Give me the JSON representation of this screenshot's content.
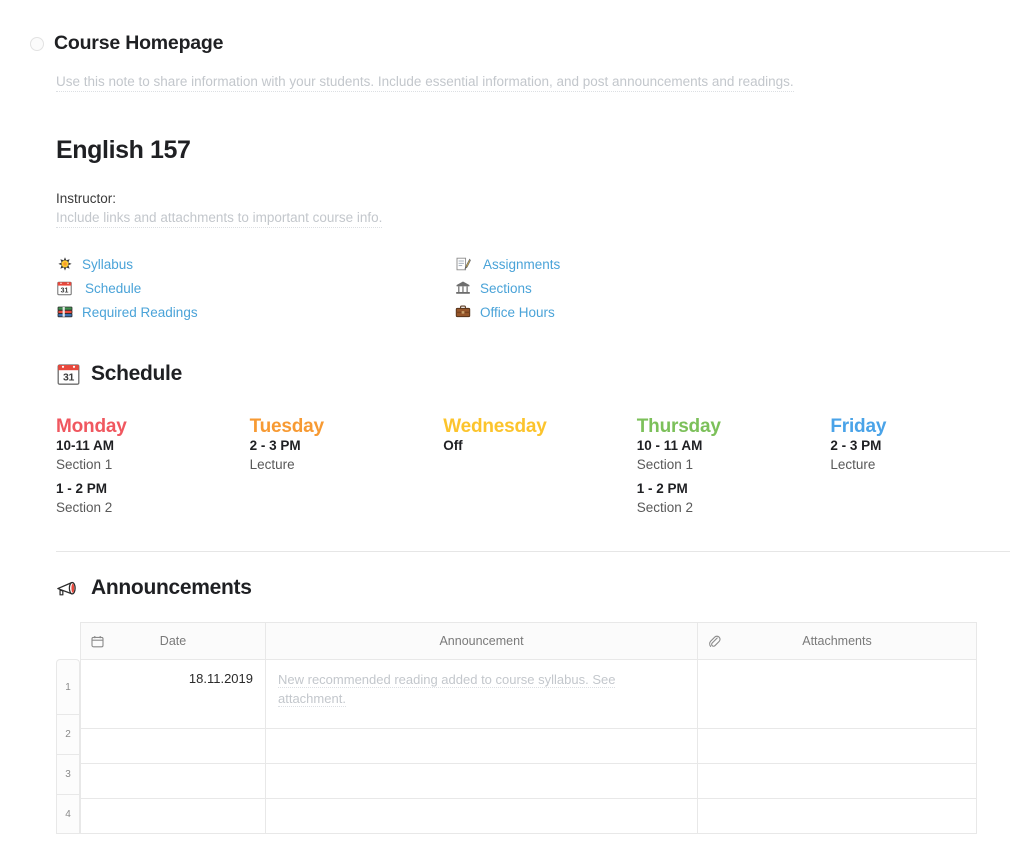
{
  "note": {
    "radio_icon": "radio-unchecked-icon",
    "title": "Course Homepage",
    "placeholder": "Use this note to share information with your students. Include essential information, and post announcements and readings."
  },
  "course": {
    "title": "English 157",
    "instructor_label": "Instructor:",
    "instructor_placeholder": "Include links and attachments to important course info."
  },
  "quick_links": {
    "left": [
      {
        "icon": "sparkle-star-icon",
        "label": "Syllabus"
      },
      {
        "icon": "calendar-31-icon",
        "label": "Schedule"
      },
      {
        "icon": "stacked-books-icon",
        "label": "Required Readings"
      }
    ],
    "right": [
      {
        "icon": "memo-pencil-icon",
        "label": "Assignments"
      },
      {
        "icon": "classical-building-icon",
        "label": "Sections"
      },
      {
        "icon": "briefcase-icon",
        "label": "Office Hours"
      }
    ]
  },
  "schedule": {
    "heading": "Schedule",
    "heading_icon": "calendar-31-icon",
    "days": [
      {
        "name": "Monday",
        "color": "#f0575f",
        "slots": [
          {
            "time": "10-11 AM",
            "desc": "Section 1"
          },
          {
            "time": "1 - 2 PM",
            "desc": "Section 2"
          }
        ]
      },
      {
        "name": "Tuesday",
        "color": "#f79a33",
        "slots": [
          {
            "time": "2 - 3 PM",
            "desc": "Lecture"
          }
        ]
      },
      {
        "name": "Wednesday",
        "color": "#fcc42c",
        "slots": [
          {
            "time": "Off",
            "desc": ""
          }
        ]
      },
      {
        "name": "Thursday",
        "color": "#7cc05a",
        "slots": [
          {
            "time": "10 - 11 AM",
            "desc": "Section 1"
          },
          {
            "time": "1 - 2 PM",
            "desc": "Section 2"
          }
        ]
      },
      {
        "name": "Friday",
        "color": "#4aa3e8",
        "slots": [
          {
            "time": "2 - 3 PM",
            "desc": "Lecture"
          }
        ]
      }
    ]
  },
  "announcements": {
    "heading": "Announcements",
    "heading_icon": "megaphone-icon",
    "columns": [
      {
        "label": "Date",
        "icon": "calendar-outline-icon"
      },
      {
        "label": "Announcement",
        "icon": ""
      },
      {
        "label": "Attachments",
        "icon": "paperclip-icon"
      }
    ],
    "row_numbers": [
      "1",
      "2",
      "3",
      "4"
    ],
    "rows": [
      {
        "date": "18.11.2019",
        "announcement": "New recommended reading added to course syllabus. See attachment.",
        "attachments": ""
      },
      {
        "date": "",
        "announcement": "",
        "attachments": ""
      },
      {
        "date": "",
        "announcement": "",
        "attachments": ""
      },
      {
        "date": "",
        "announcement": "",
        "attachments": ""
      }
    ]
  }
}
